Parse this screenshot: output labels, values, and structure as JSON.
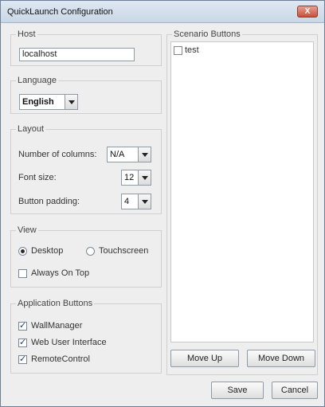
{
  "window": {
    "title": "QuickLaunch Configuration",
    "close_label": "X"
  },
  "host": {
    "legend": "Host",
    "value": "localhost"
  },
  "language": {
    "legend": "Language",
    "selected": "English"
  },
  "layout": {
    "legend": "Layout",
    "columns_label": "Number of columns:",
    "columns_value": "N/A",
    "font_size_label": "Font size:",
    "font_size_value": "12",
    "padding_label": "Button padding:",
    "padding_value": "4"
  },
  "view": {
    "legend": "View",
    "desktop_label": "Desktop",
    "touchscreen_label": "Touchscreen",
    "always_on_top_label": "Always On Top"
  },
  "app_buttons": {
    "legend": "Application Buttons",
    "items": [
      "WallManager",
      "Web User Interface",
      "RemoteControl"
    ]
  },
  "scenario": {
    "legend": "Scenario Buttons",
    "items": [
      "test"
    ],
    "move_up": "Move Up",
    "move_down": "Move Down"
  },
  "footer": {
    "save": "Save",
    "cancel": "Cancel"
  }
}
